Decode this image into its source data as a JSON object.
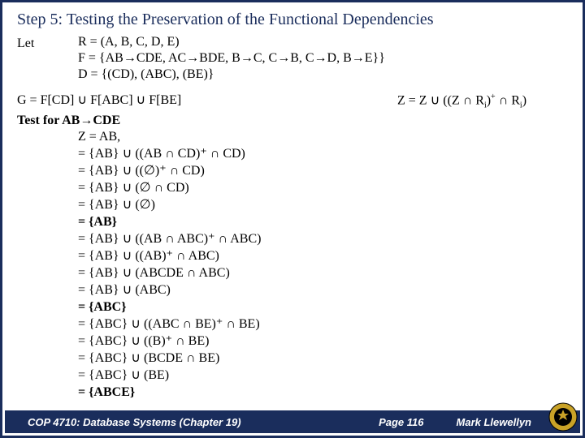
{
  "title": "Step 5: Testing the Preservation of the Functional Dependencies",
  "let_label": "Let",
  "let": {
    "r": "R = (A, B, C, D, E)",
    "f": "F = {AB→CDE, AC→BDE, B→C, C→B, C→D, B→E}}",
    "d": "D = {(CD), (ABC), (BE)}"
  },
  "g_line": "G = F[CD] ∪ F[ABC] ∪ F[BE]",
  "z_line_pre": "Z = Z ∪ ((Z ∩ R",
  "z_line_mid": ")",
  "z_line_post": " ∩ R",
  "z_line_end": ")",
  "test_label": "Test for AB→CDE",
  "steps": [
    "Z = AB,",
    "= {AB} ∪ ((AB ∩ CD)⁺ ∩ CD)",
    "= {AB} ∪ ((∅)⁺ ∩ CD)",
    "= {AB} ∪ (∅ ∩ CD)",
    "= {AB} ∪ (∅)",
    "= {AB}",
    "= {AB} ∪ ((AB ∩ ABC)⁺ ∩ ABC)",
    "= {AB} ∪ ((AB)⁺ ∩ ABC)",
    "= {AB} ∪ (ABCDE ∩ ABC)",
    "= {AB} ∪ (ABC)",
    "= {ABC}",
    "= {ABC} ∪ ((ABC ∩ BE)⁺ ∩ BE)",
    "= {ABC} ∪ ((B)⁺ ∩ BE)",
    "= {ABC} ∪ (BCDE ∩ BE)",
    "= {ABC} ∪ (BE)",
    "= {ABCE}"
  ],
  "bold_steps": [
    5,
    10,
    15
  ],
  "footer": {
    "left": "COP 4710: Database Systems  (Chapter 19)",
    "center": "Page 116",
    "right": "Mark Llewellyn"
  }
}
